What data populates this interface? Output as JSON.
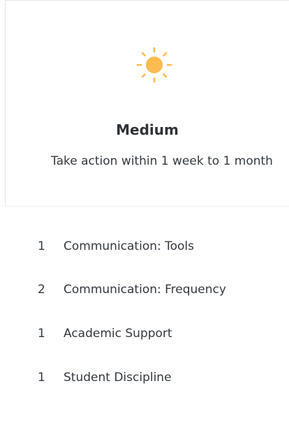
{
  "card": {
    "icon": "sun-icon",
    "icon_color": "#fcbc51",
    "title": "Medium",
    "description": "Take action within 1 week to 1 month"
  },
  "list": {
    "items": [
      {
        "count": "1",
        "label": "Communication: Tools"
      },
      {
        "count": "2",
        "label": "Communication: Frequency"
      },
      {
        "count": "1",
        "label": "Academic Support"
      },
      {
        "count": "1",
        "label": "Student Discipline"
      }
    ]
  }
}
